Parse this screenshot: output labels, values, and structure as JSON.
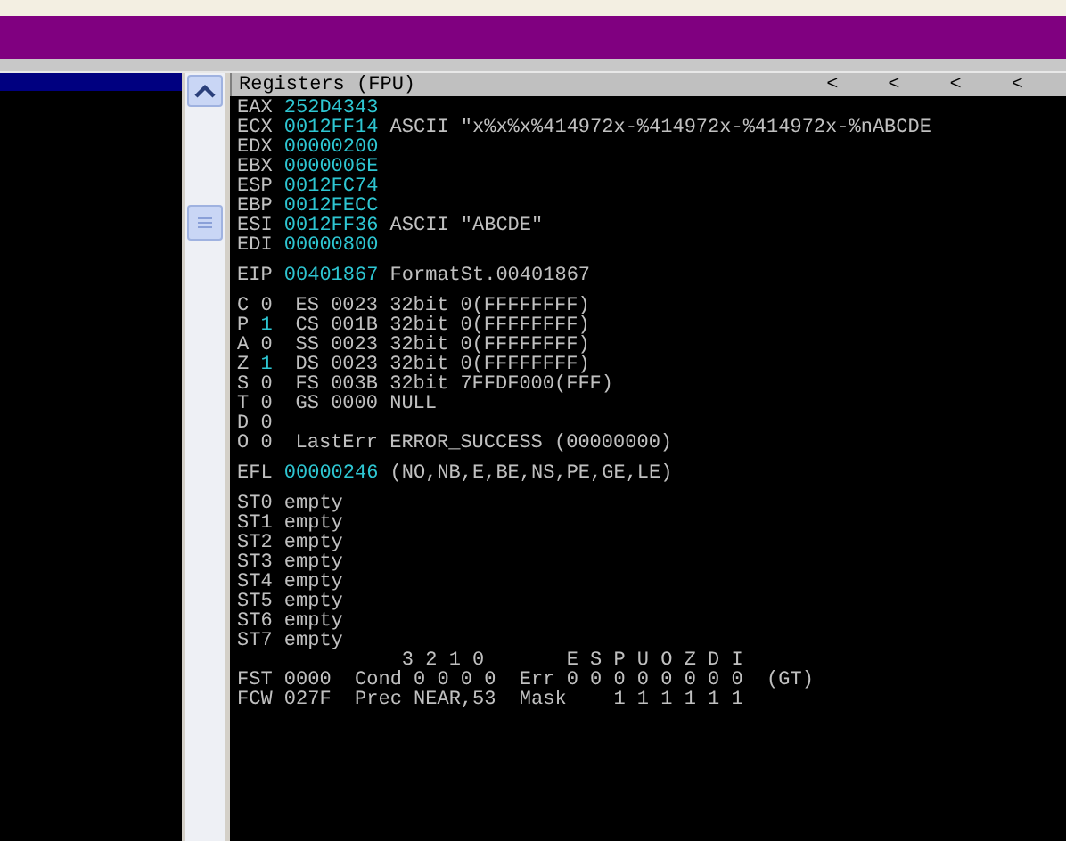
{
  "registers_panel": {
    "title": "Registers (FPU)",
    "header_arrows": [
      "<",
      "<",
      "<",
      "<"
    ],
    "registers": [
      {
        "name": "EAX",
        "value": "252D4343",
        "highlighted": true
      },
      {
        "name": "ECX",
        "value": "0012FF14",
        "comment": "ASCII \"x%x%x%414972x-%414972x-%414972x-%nABCDE",
        "highlighted": true
      },
      {
        "name": "EDX",
        "value": "00000200",
        "highlighted": true
      },
      {
        "name": "EBX",
        "value": "0000006E",
        "highlighted": true
      },
      {
        "name": "ESP",
        "value": "0012FC74",
        "highlighted": true
      },
      {
        "name": "EBP",
        "value": "0012FECC",
        "highlighted": true
      },
      {
        "name": "ESI",
        "value": "0012FF36",
        "comment": "ASCII \"ABCDE\"",
        "highlighted": true
      },
      {
        "name": "EDI",
        "value": "00000800",
        "highlighted": true
      }
    ],
    "eip": {
      "name": "EIP",
      "value": "00401867",
      "comment": "FormatSt.00401867",
      "highlighted": true
    },
    "flags": [
      {
        "flag": "C",
        "bit": "0",
        "highlighted": false,
        "detail": "ES 0023 32bit 0(FFFFFFFF)"
      },
      {
        "flag": "P",
        "bit": "1",
        "highlighted": true,
        "detail": "CS 001B 32bit 0(FFFFFFFF)"
      },
      {
        "flag": "A",
        "bit": "0",
        "highlighted": false,
        "detail": "SS 0023 32bit 0(FFFFFFFF)"
      },
      {
        "flag": "Z",
        "bit": "1",
        "highlighted": true,
        "detail": "DS 0023 32bit 0(FFFFFFFF)"
      },
      {
        "flag": "S",
        "bit": "0",
        "highlighted": false,
        "detail": "FS 003B 32bit 7FFDF000(FFF)"
      },
      {
        "flag": "T",
        "bit": "0",
        "highlighted": false,
        "detail": "GS 0000 NULL"
      },
      {
        "flag": "D",
        "bit": "0",
        "highlighted": false
      },
      {
        "flag": "O",
        "bit": "0",
        "highlighted": false,
        "detail": "LastErr ERROR_SUCCESS (00000000)"
      }
    ],
    "efl": {
      "name": "EFL",
      "value": "00000246",
      "comment": "(NO,NB,E,BE,NS,PE,GE,LE)",
      "highlighted": true
    },
    "fpu_stack": [
      {
        "name": "ST0",
        "value": "empty"
      },
      {
        "name": "ST1",
        "value": "empty"
      },
      {
        "name": "ST2",
        "value": "empty"
      },
      {
        "name": "ST3",
        "value": "empty"
      },
      {
        "name": "ST4",
        "value": "empty"
      },
      {
        "name": "ST5",
        "value": "empty"
      },
      {
        "name": "ST6",
        "value": "empty"
      },
      {
        "name": "ST7",
        "value": "empty"
      }
    ],
    "fpu_status": [
      "              3 2 1 0       E S P U O Z D I",
      "FST 0000  Cond 0 0 0 0  Err 0 0 0 0 0 0 0 0  (GT)",
      "FCW 027F  Prec NEAR,53  Mask    1 1 1 1 1 1"
    ]
  }
}
